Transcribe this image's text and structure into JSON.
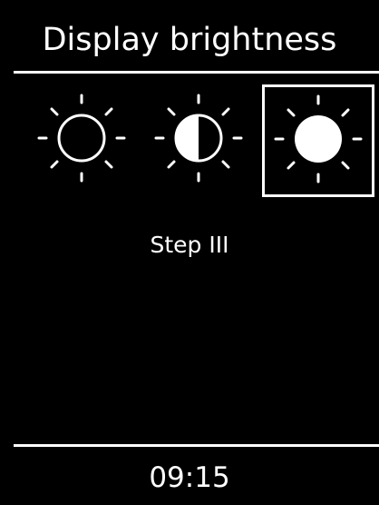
{
  "title": "Display brightness",
  "brightness_options": [
    {
      "icon": "sun-outline-icon",
      "selected": false
    },
    {
      "icon": "sun-half-icon",
      "selected": false
    },
    {
      "icon": "sun-filled-icon",
      "selected": true
    }
  ],
  "step_label": "Step III",
  "clock": "09:15",
  "colors": {
    "background": "#000000",
    "foreground": "#ffffff"
  }
}
